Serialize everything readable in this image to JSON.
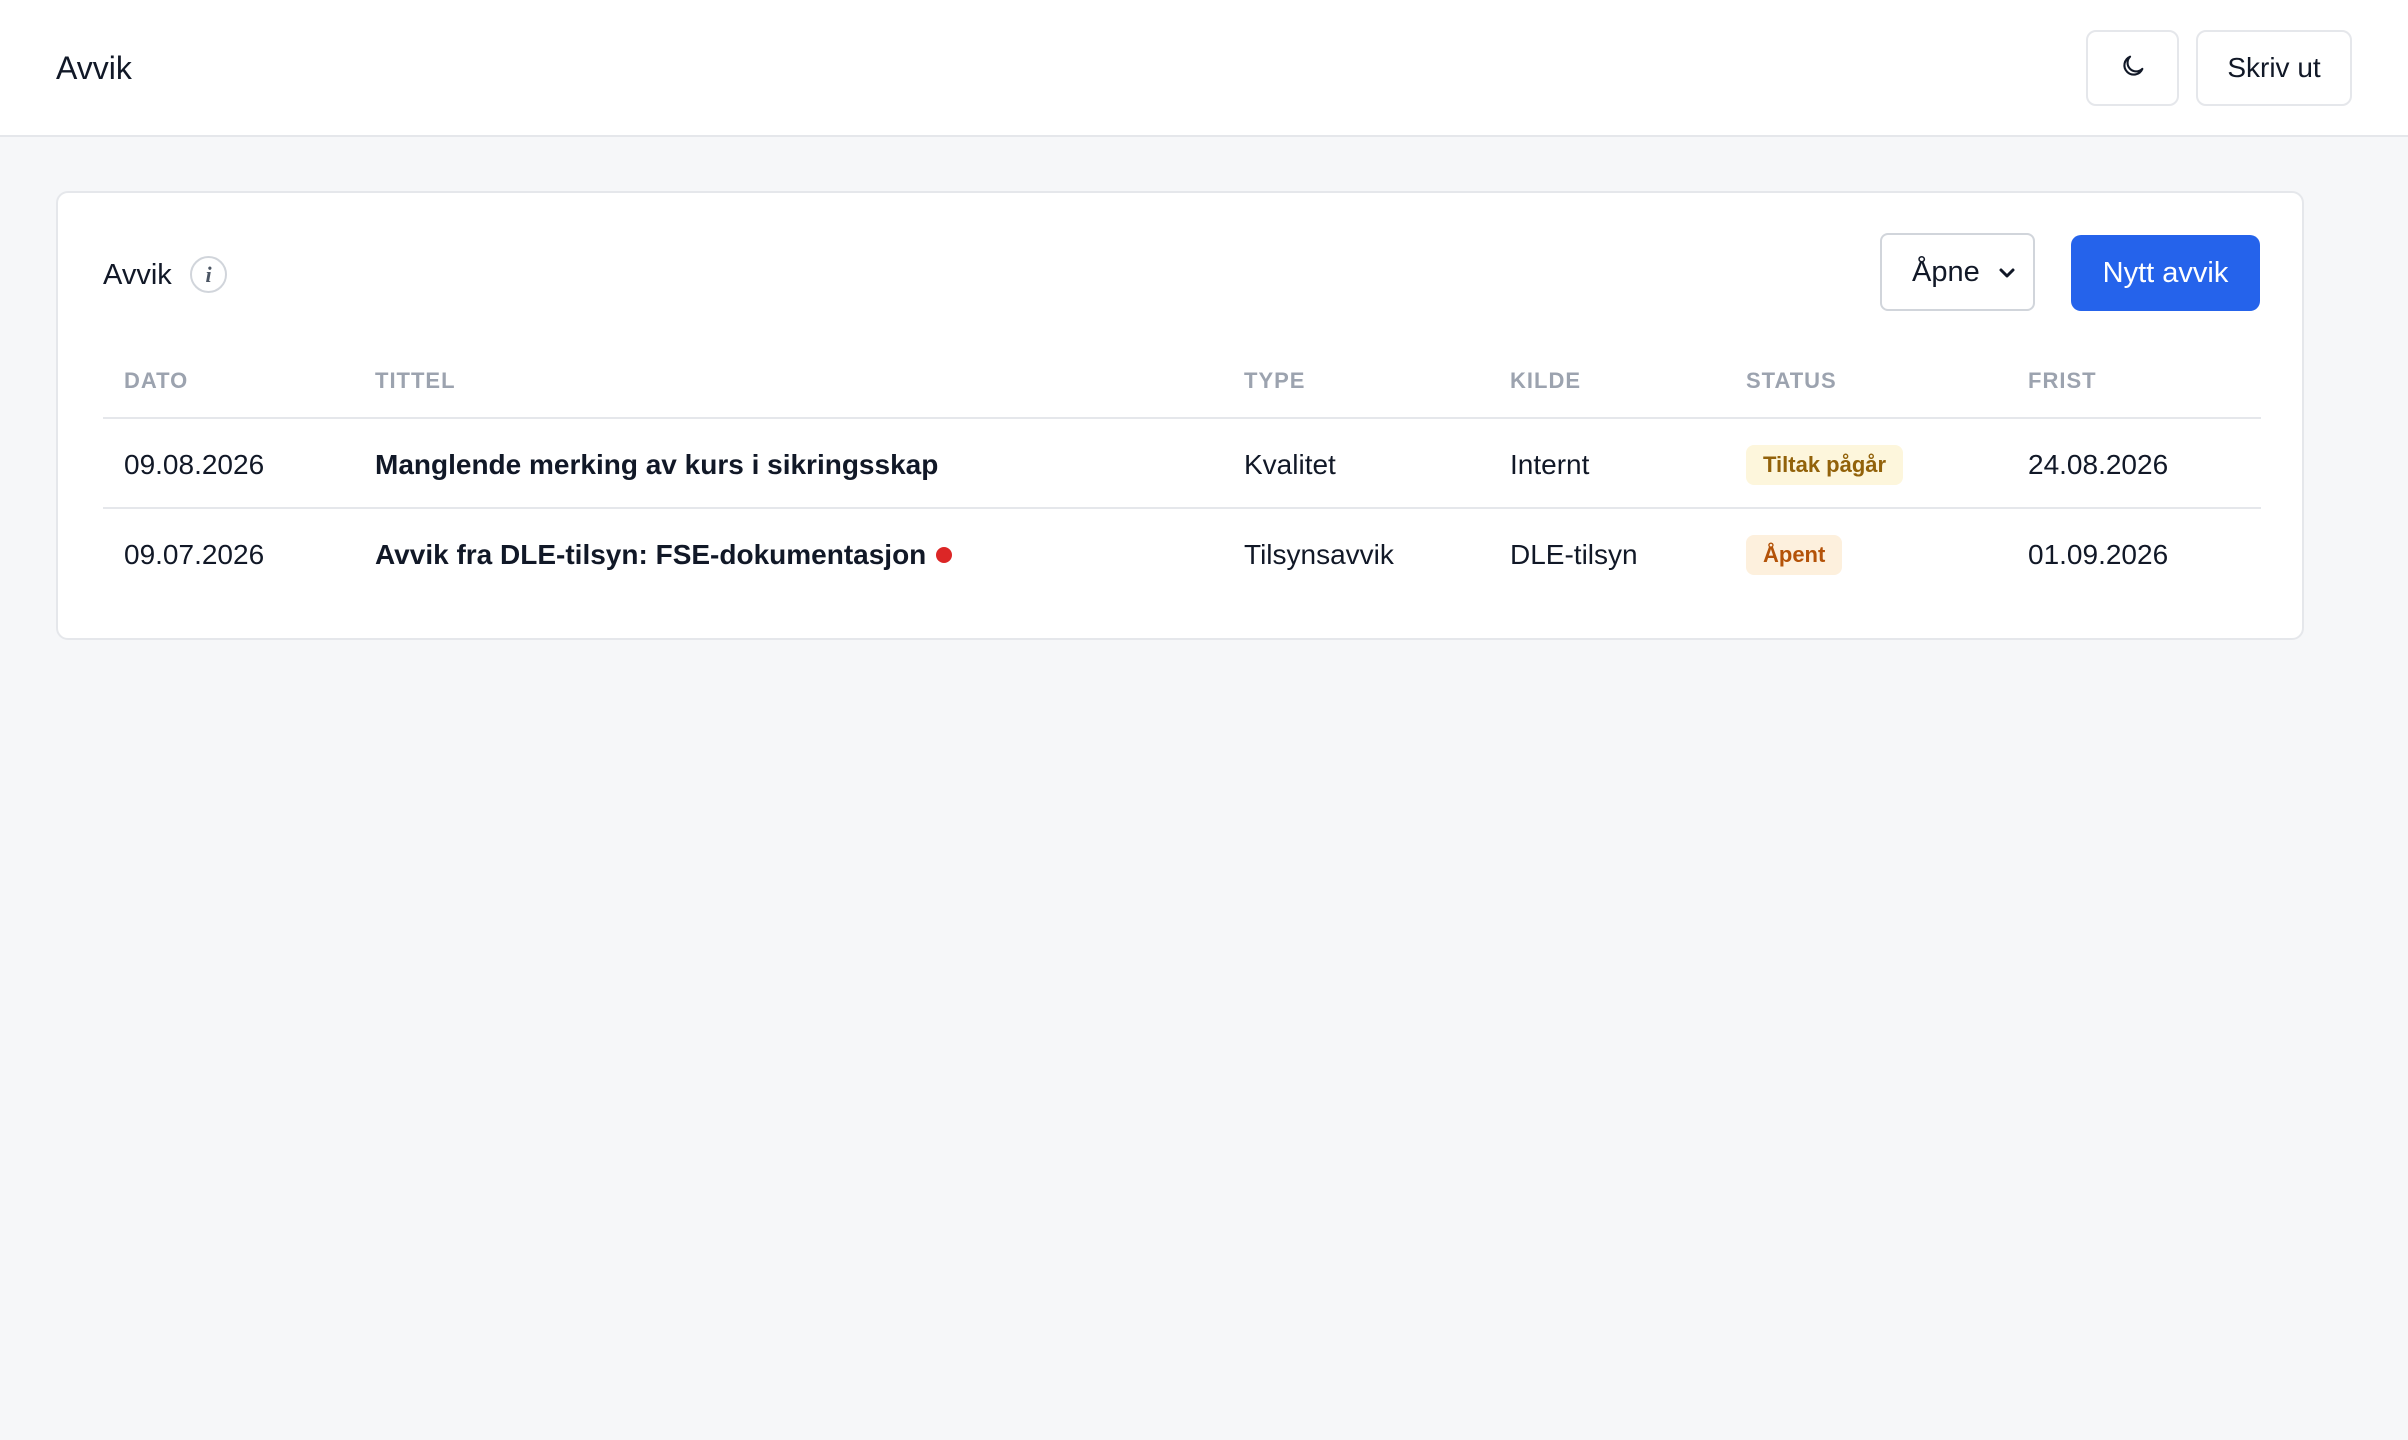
{
  "header": {
    "title": "Avvik",
    "print_label": "Skriv ut",
    "theme_icon": "moon-icon"
  },
  "card": {
    "title": "Avvik",
    "info_icon_glyph": "i",
    "filter": {
      "selected": "Åpne"
    },
    "new_button_label": "Nytt avvik",
    "accent_color": "#2563eb"
  },
  "table": {
    "columns": [
      "DATO",
      "TITTEL",
      "TYPE",
      "KILDE",
      "STATUS",
      "FRIST"
    ],
    "rows": [
      {
        "dato": "09.08.2026",
        "tittel": "Manglende merking av kurs i sikringsskap",
        "type": "Kvalitet",
        "kilde": "Internt",
        "status": "Tiltak pågår",
        "frist": "24.08.2026",
        "flag": false
      },
      {
        "dato": "09.07.2026",
        "tittel": "Avvik fra DLE-tilsyn: FSE-dokumentasjon",
        "type": "Tilsynsavvik",
        "kilde": "DLE-tilsyn",
        "status": "Åpent",
        "frist": "01.09.2026",
        "flag": true
      }
    ]
  }
}
